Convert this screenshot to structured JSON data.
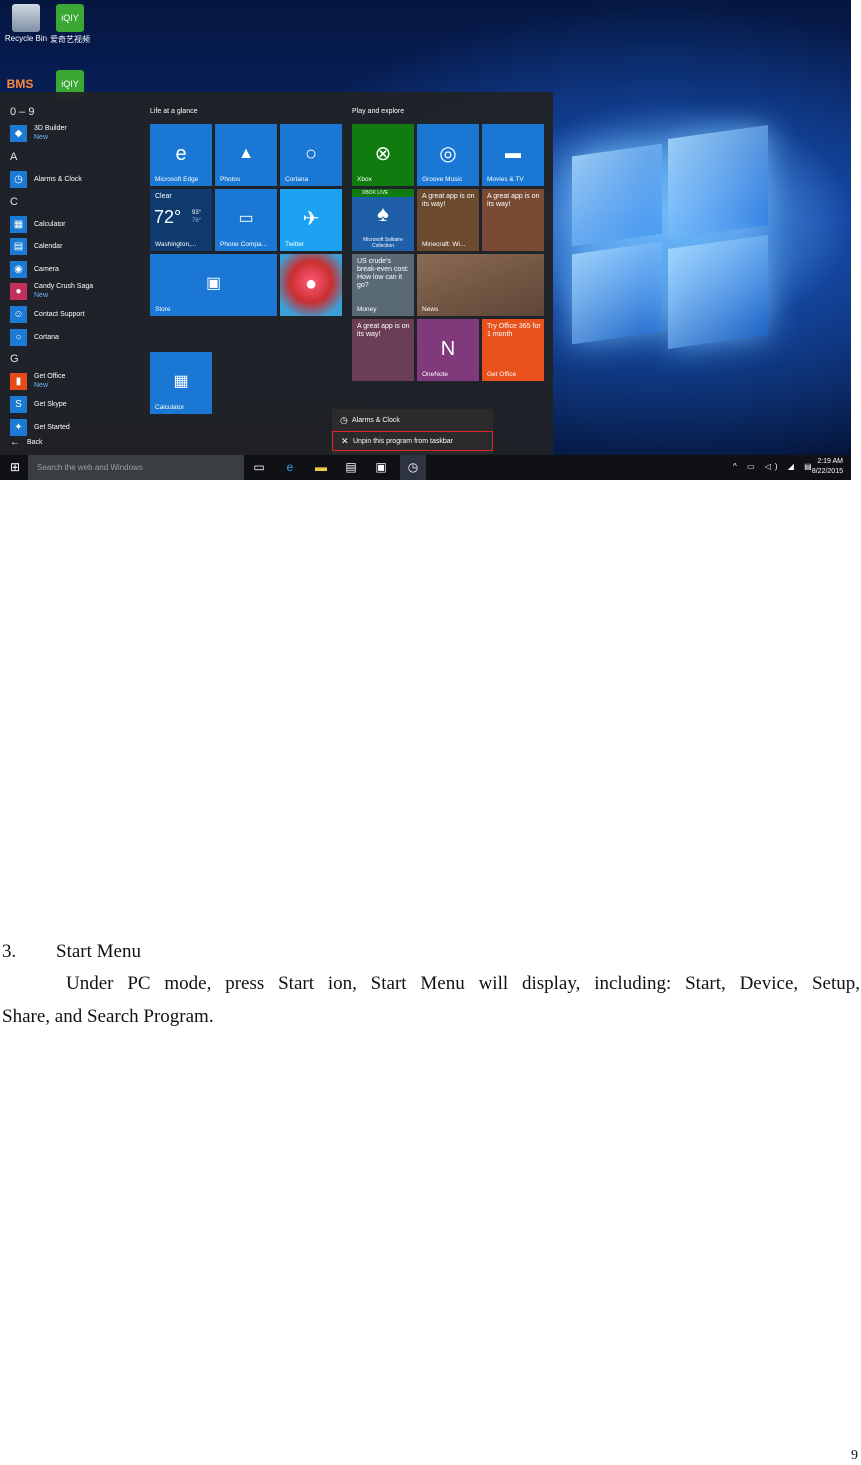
{
  "desktop": {
    "icons": [
      "Recycle Bin",
      "爱奇艺视频",
      "BMS",
      "iQIY"
    ]
  },
  "start_menu": {
    "letters": [
      "0 – 9",
      "A",
      "C",
      "G"
    ],
    "apps": [
      {
        "name": "3D Builder",
        "badge": "New"
      },
      {
        "name": "Alarms & Clock",
        "badge": ""
      },
      {
        "name": "Calculator",
        "badge": ""
      },
      {
        "name": "Calendar",
        "badge": ""
      },
      {
        "name": "Camera",
        "badge": ""
      },
      {
        "name": "Candy Crush Saga",
        "badge": "New"
      },
      {
        "name": "Contact Support",
        "badge": ""
      },
      {
        "name": "Cortana",
        "badge": ""
      },
      {
        "name": "Get Office",
        "badge": "New"
      },
      {
        "name": "Get Skype",
        "badge": ""
      },
      {
        "name": "Get Started",
        "badge": ""
      }
    ],
    "back": "Back",
    "groups": [
      "Life at a glance",
      "Play and explore"
    ],
    "tiles": {
      "edge": "Microsoft Edge",
      "photos": "Photos",
      "cortana": "Cortana",
      "weather_cond": "Clear",
      "weather_temp": "72°",
      "weather_hi": "93°",
      "weather_lo": "76°",
      "weather_city": "Washington,...",
      "phone": "Phone Compa...",
      "twitter": "Twitter",
      "store": "Store",
      "calculator": "Calculator",
      "xbox": "Xbox",
      "groove": "Groove Music",
      "movies": "Movies & TV",
      "xbox_live": "XBOX LIVE",
      "solitaire": "Microsoft Solitaire Collection",
      "great_app": "A great app is on its way!",
      "minecraft": "Minecraft: Wi...",
      "money_text": "US crude's break-even cost: How low can it go?",
      "money": "Money",
      "news": "News",
      "onenote": "OneNote",
      "office_text": "Try Office 365 for 1 month",
      "get_office": "Get Office"
    }
  },
  "context_menu": {
    "item1": "Alarms & Clock",
    "item2": "Unpin this program from taskbar"
  },
  "taskbar": {
    "search_placeholder": "Search the web and Windows",
    "time": "2:19 AM",
    "date": "8/22/2015"
  },
  "document": {
    "section_number": "3.",
    "section_title": "Start Menu",
    "paragraph_line1": "Under PC mode, press Start ion, Start Menu will display, including: Start, Device, Setup,",
    "paragraph_line2": "Share, and Search Program.",
    "page_number": "9"
  }
}
